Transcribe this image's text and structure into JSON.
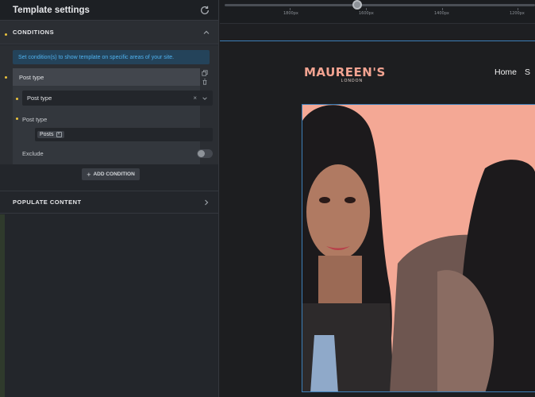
{
  "panel": {
    "title": "Template settings",
    "conditions_label": "CONDITIONS",
    "notice": "Set condition(s) to show template on specific areas of your site.",
    "card_title": "Post type",
    "select_value": "Post type",
    "sub_label": "Post type",
    "tag": "Posts",
    "exclude_label": "Exclude",
    "exclude_on": false,
    "add_condition": "ADD CONDITION",
    "populate_label": "POPULATE CONTENT"
  },
  "ruler": {
    "ticks": [
      "1800px",
      "1600px",
      "1400px",
      "1200px"
    ]
  },
  "preview": {
    "logo": "MAUREEN'S",
    "logo_sub": "LONDON",
    "nav": [
      "Home",
      "S"
    ]
  },
  "colors": {
    "accent": "#e9c23d",
    "notice_text": "#4fb2ef",
    "hero_bg": "#f4a895",
    "logo": "#f2a391"
  }
}
